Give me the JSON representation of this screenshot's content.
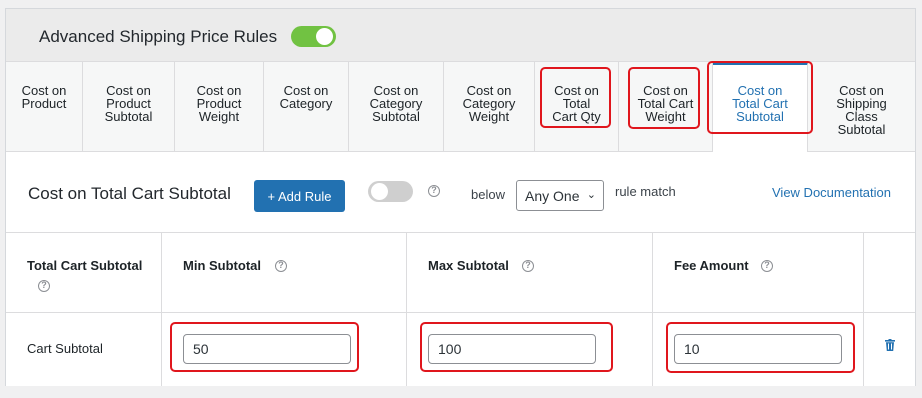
{
  "header": {
    "title": "Advanced Shipping Price Rules",
    "enabled": true,
    "toggle_color": "#71c242"
  },
  "tabs": [
    {
      "label": "Cost on\nProduct",
      "active": false
    },
    {
      "label": "Cost on\nProduct\nSubtotal",
      "active": false
    },
    {
      "label": "Cost on\nProduct\nWeight",
      "active": false
    },
    {
      "label": "Cost on\nCategory",
      "active": false
    },
    {
      "label": "Cost on\nCategory\nSubtotal",
      "active": false
    },
    {
      "label": "Cost on\nCategory\nWeight",
      "active": false
    },
    {
      "label": "Cost on\nTotal\nCart Qty",
      "active": false
    },
    {
      "label": "Cost on\nTotal Cart\nWeight",
      "active": false
    },
    {
      "label": "Cost on\nTotal Cart\nSubtotal",
      "active": true
    },
    {
      "label": "Cost on\nShipping\nClass\nSubtotal",
      "active": false
    }
  ],
  "section": {
    "title": "Cost on Total Cart Subtotal",
    "add_rule_label": "+ Add Rule",
    "enabled": false,
    "below_label": "below",
    "match_select": "Any One",
    "rule_match_label": "rule match",
    "doc_link": "View Documentation"
  },
  "table": {
    "headers": [
      "Total Cart Subtotal",
      "Min Subtotal",
      "Max Subtotal",
      "Fee Amount"
    ],
    "row": {
      "label": "Cart Subtotal",
      "min": "50",
      "max": "100",
      "fee": "10"
    }
  },
  "icons": {
    "help": "question-circle-icon",
    "delete": "trash-icon",
    "select": "chevron-down-icon"
  },
  "colors": {
    "accent": "#2271b1",
    "highlight": "#e0161d"
  }
}
